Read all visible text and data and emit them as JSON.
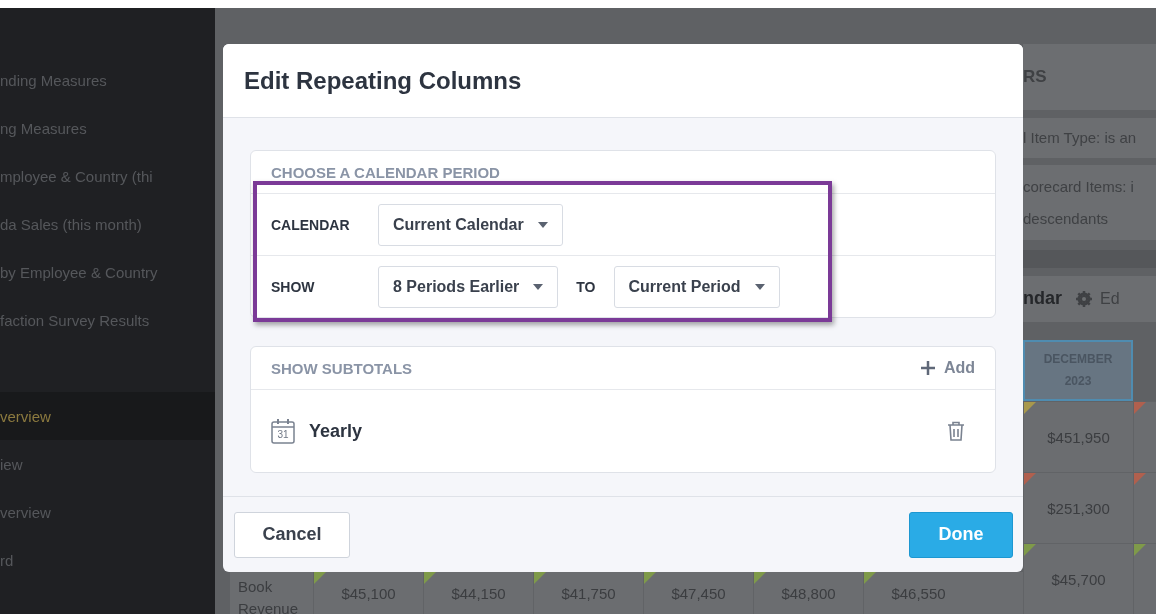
{
  "sidebar": {
    "items": [
      {
        "label": "nding Measures",
        "selected": false
      },
      {
        "label": "ng Measures",
        "selected": false
      },
      {
        "label": "mployee & Country (thi",
        "selected": false
      },
      {
        "label": "da Sales (this month)",
        "selected": false
      },
      {
        "label": "by Employee & Country",
        "selected": false
      },
      {
        "label": "faction Survey Results",
        "selected": false
      },
      {
        "label": "verview",
        "selected": true
      },
      {
        "label": "iew",
        "selected": false
      },
      {
        "label": "verview",
        "selected": false
      },
      {
        "label": "rd",
        "selected": false
      }
    ]
  },
  "background_report": {
    "heading": "RS",
    "filters": [
      "l Item Type: is an",
      "corecard Items: i descendants"
    ],
    "toolbar": {
      "title": "ndar",
      "action": "Ed"
    },
    "table": {
      "column": "DECEMBER 2023",
      "rows": [
        {
          "cells": [
            {
              "value": "$451,950",
              "color": "#a8984c"
            },
            {
              "color": "#b0604e"
            }
          ]
        },
        {
          "cells": [
            {
              "value": "$251,300",
              "color": "#b0604e"
            },
            {
              "color": "#b0604e"
            }
          ]
        },
        {
          "cells": [
            {
              "value": "$45,700",
              "color": "#7f9a4a"
            },
            {
              "color": "#7f9a4a"
            }
          ]
        }
      ]
    },
    "bottom_row": {
      "label": "Book Revenue",
      "cells": [
        {
          "value": "$45,100",
          "color": "#7f9a4a"
        },
        {
          "value": "$44,150",
          "color": "#7f9a4a"
        },
        {
          "value": "$41,750",
          "color": "#7f9a4a"
        },
        {
          "value": "$47,450",
          "color": "#7f9a4a"
        },
        {
          "value": "$48,800",
          "color": "#7f9a4a"
        },
        {
          "value": "$46,550",
          "color": "#7f9a4a"
        }
      ]
    }
  },
  "dialog": {
    "title": "Edit Repeating Columns",
    "period_section": {
      "heading": "CHOOSE A CALENDAR PERIOD",
      "calendar": {
        "label": "CALENDAR",
        "value": "Current Calendar"
      },
      "show": {
        "label": "SHOW",
        "from": "8 Periods Earlier",
        "separator": "TO",
        "to": "Current Period"
      }
    },
    "subtotals_section": {
      "heading": "SHOW SUBTOTALS",
      "add_label": "Add",
      "items": [
        {
          "icon_text": "31",
          "label": "Yearly"
        }
      ]
    },
    "buttons": {
      "cancel": "Cancel",
      "done": "Done"
    }
  }
}
